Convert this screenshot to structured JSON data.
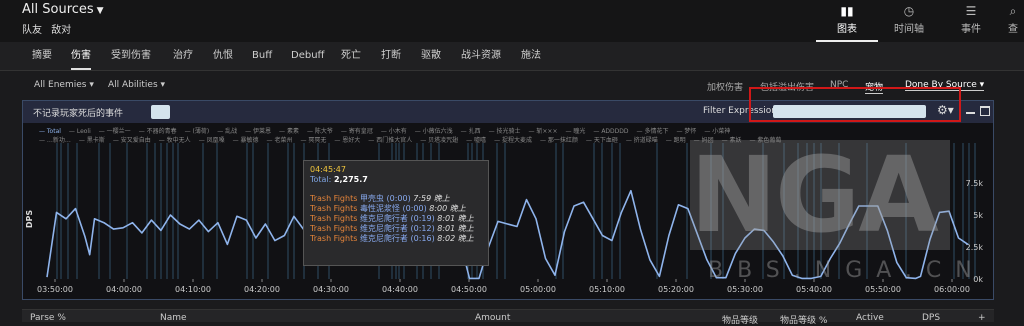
{
  "header": {
    "source_title": "All Sources",
    "tabs": [
      "队友",
      "敌对"
    ],
    "views": [
      {
        "label": "图表",
        "icon": "bar-chart-icon",
        "active": true
      },
      {
        "label": "时间轴",
        "icon": "clock-icon",
        "active": false
      },
      {
        "label": "事件",
        "icon": "list-icon",
        "active": false
      },
      {
        "label": "查",
        "icon": "magnifier-icon",
        "active": false
      }
    ]
  },
  "nav_tabs": [
    "摘要",
    "伤害",
    "受到伤害",
    "治疗",
    "仇恨",
    "Buff",
    "Debuff",
    "死亡",
    "打断",
    "驱散",
    "战斗资源",
    "施法"
  ],
  "active_tab": "伤害",
  "filters": {
    "enemies": "All Enemies",
    "abilities": "All Abilities",
    "options": [
      "加权伤害",
      "包括溢出伤害",
      "NPC",
      "宠物"
    ],
    "grouping": "Done By Source"
  },
  "panel": {
    "death_toggle_label": "不记录玩家死后的事件",
    "filter_label": "Filter Expression:",
    "filter_value": ""
  },
  "legend_row1": [
    "Total",
    "Leoli",
    "一樱兰一",
    "不器的青春",
    "(薄荷)",
    "乱战",
    "伊莱恩",
    "素素",
    "陈大爷",
    "寄有皇冠",
    "小木有",
    "小薇伍六浅",
    "扎西",
    "技光骑士",
    "斩×××",
    "瞳光",
    "ADDDDD",
    "多情花下",
    "梦怀",
    "小菜神"
  ],
  "legend_row2": [
    "…新功…",
    "黑卡斯",
    "安又爱自由",
    "牧中无人",
    "凤凰嗓",
    "暴敏德",
    "老菜州",
    "冥冥无",
    "恩好大",
    "西门推大官人",
    "贝塔凌咒翅",
    "嘘嘻",
    "捉程大麦成",
    "那一抹红颜",
    "天下血砸",
    "挤道碌喵",
    "跑明",
    "妈团",
    "素妖",
    "紫色葡萄"
  ],
  "tooltip": {
    "time": "04:45:47",
    "total_label": "Total:",
    "total_value": "2,275.7",
    "rows": [
      {
        "encounter": "Trash Fights",
        "spell": "甲壳虫 (0:00)",
        "ts": "7:59 晚上"
      },
      {
        "encounter": "Trash Fights",
        "spell": "毒性泥浆怪 (0:00)",
        "ts": "8:00 晚上"
      },
      {
        "encounter": "Trash Fights",
        "spell": "维克尼爬行者 (0:19)",
        "ts": "8:01 晚上"
      },
      {
        "encounter": "Trash Fights",
        "spell": "维克尼爬行者 (0:12)",
        "ts": "8:01 晚上"
      },
      {
        "encounter": "Trash Fights",
        "spell": "维克尼爬行者 (0:16)",
        "ts": "8:02 晚上"
      }
    ]
  },
  "watermark": {
    "main": "NGA",
    "sub": "BBS.NGA.CN"
  },
  "table_headers": [
    "Parse %",
    "Name",
    "Amount",
    "物品等级",
    "物品等级 %",
    "Active",
    "DPS",
    "+"
  ],
  "chart_data": {
    "type": "line",
    "ylabel": "DPS",
    "x_ticks": [
      "03:50:00",
      "04:00:00",
      "04:10:00",
      "04:20:00",
      "04:30:00",
      "04:40:00",
      "04:50:00",
      "05:00:00",
      "05:10:00",
      "05:20:00",
      "05:30:00",
      "05:40:00",
      "05:50:00",
      "06:00:00"
    ],
    "y_ticks": [
      "0k",
      "2.5k",
      "5k",
      "7.5k"
    ],
    "ylim": [
      0,
      10000
    ],
    "series": [
      {
        "name": "Total",
        "color": "#8fb4ec",
        "points": [
          [
            0,
            150
          ],
          [
            2,
            5200
          ],
          [
            4,
            4700
          ],
          [
            6,
            5500
          ],
          [
            8,
            3300
          ],
          [
            9,
            1900
          ],
          [
            10,
            4700
          ],
          [
            12,
            4400
          ],
          [
            14,
            3900
          ],
          [
            16,
            4000
          ],
          [
            18,
            4400
          ],
          [
            20,
            3600
          ],
          [
            22,
            4600
          ],
          [
            24,
            3800
          ],
          [
            26,
            5000
          ],
          [
            28,
            4300
          ],
          [
            30,
            3900
          ],
          [
            32,
            4600
          ],
          [
            34,
            3700
          ],
          [
            36,
            4400
          ],
          [
            38,
            2700
          ],
          [
            40,
            4900
          ],
          [
            42,
            4600
          ],
          [
            44,
            3200
          ],
          [
            46,
            4300
          ],
          [
            48,
            3000
          ],
          [
            50,
            3400
          ],
          [
            52,
            4900
          ],
          [
            54,
            3900
          ],
          [
            56,
            5900
          ],
          [
            58,
            2900
          ],
          [
            60,
            4300
          ],
          [
            62,
            2600
          ],
          [
            64,
            4000
          ],
          [
            66,
            3500
          ],
          [
            68,
            4200
          ],
          [
            70,
            2900
          ],
          [
            72,
            5200
          ],
          [
            74,
            3900
          ],
          [
            76,
            5500
          ],
          [
            78,
            3700
          ],
          [
            80,
            5200
          ],
          [
            82,
            4300
          ],
          [
            84,
            5400
          ],
          [
            86,
            3100
          ],
          [
            88,
            1500
          ],
          [
            89,
            50
          ],
          [
            91,
            50
          ],
          [
            93,
            2500
          ],
          [
            95,
            4500
          ],
          [
            97,
            4300
          ],
          [
            99,
            4100
          ],
          [
            101,
            6200
          ],
          [
            103,
            4700
          ],
          [
            105,
            1600
          ],
          [
            107,
            300
          ],
          [
            109,
            3700
          ],
          [
            111,
            5700
          ],
          [
            113,
            6000
          ],
          [
            115,
            4700
          ],
          [
            117,
            3400
          ],
          [
            119,
            3000
          ],
          [
            121,
            5200
          ],
          [
            123,
            6900
          ],
          [
            125,
            3900
          ],
          [
            127,
            1500
          ],
          [
            129,
            200
          ],
          [
            131,
            3400
          ],
          [
            133,
            5800
          ],
          [
            135,
            5500
          ],
          [
            137,
            3500
          ],
          [
            139,
            1500
          ],
          [
            141,
            100
          ],
          [
            143,
            100
          ],
          [
            145,
            2000
          ],
          [
            147,
            3200
          ],
          [
            149,
            3900
          ],
          [
            151,
            3800
          ],
          [
            153,
            2900
          ],
          [
            155,
            1800
          ],
          [
            157,
            300
          ],
          [
            159,
            50
          ],
          [
            161,
            50
          ],
          [
            163,
            200
          ],
          [
            165,
            1600
          ],
          [
            167,
            2800
          ],
          [
            169,
            4300
          ],
          [
            171,
            5700
          ],
          [
            173,
            5700
          ],
          [
            175,
            5700
          ],
          [
            177,
            3800
          ],
          [
            179,
            1300
          ],
          [
            181,
            100
          ],
          [
            183,
            50
          ],
          [
            184,
            200
          ],
          [
            186,
            3100
          ],
          [
            188,
            5200
          ],
          [
            190,
            5300
          ],
          [
            192,
            3200
          ],
          [
            194,
            2700
          ]
        ]
      }
    ]
  }
}
